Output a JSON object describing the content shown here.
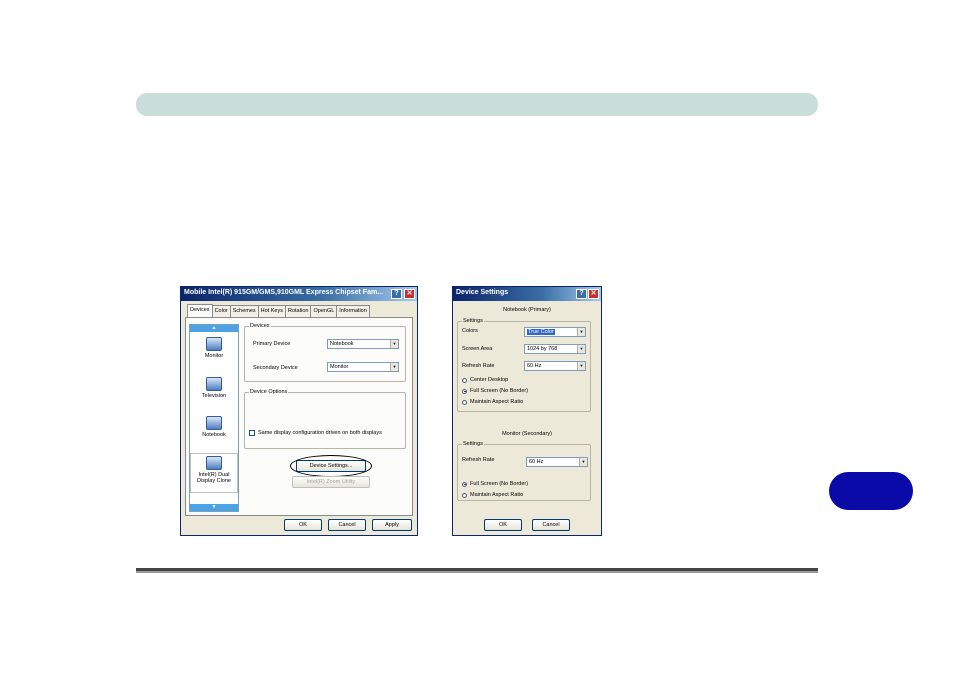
{
  "main_window": {
    "title": "Mobile Intel(R) 915GM/GMS,910GML Express Chipset Fam...",
    "help_glyph": "?",
    "close_glyph": "✕",
    "tabs": [
      "Devices",
      "Color",
      "Schemes",
      "Hot Keys",
      "Rotation",
      "OpenGL",
      "Information"
    ],
    "active_tab": "Devices",
    "sidebar": {
      "scroll_up": "▲",
      "scroll_down": "▼",
      "items": [
        {
          "label": "Monitor",
          "icon": "monitor-icon"
        },
        {
          "label": "Television",
          "icon": "television-icon"
        },
        {
          "label": "Notebook",
          "icon": "notebook-icon"
        },
        {
          "label": "Intel(R) Dual Display Clone",
          "icon": "dual-display-icon"
        }
      ]
    },
    "devices_group": {
      "label": "Devices",
      "primary_label": "Primary Device",
      "primary_value": "Notebook",
      "secondary_label": "Secondary Device",
      "secondary_value": "Monitor"
    },
    "options_group": {
      "label": "Device Options",
      "checkbox_label": "Same display configuration driven on both displays"
    },
    "device_settings_button": "Device Settings...",
    "zoom_button": "Intel(R) Zoom Utility",
    "ok_button": "OK",
    "cancel_button": "Cancel",
    "apply_button": "Apply"
  },
  "settings_window": {
    "title": "Device Settings",
    "help_glyph": "?",
    "close_glyph": "✕",
    "notebook_heading": "Notebook (Primary)",
    "notebook_group": {
      "label": "Settings",
      "colors_label": "Colors",
      "colors_value": "True Color",
      "area_label": "Screen Area",
      "area_value": "1024 by 768",
      "refresh_label": "Refresh Rate",
      "refresh_value": "60 Hz",
      "radios": [
        "Center Desktop",
        "Full Screen (No Border)",
        "Maintain Aspect Ratio"
      ],
      "selected_radio": 1
    },
    "monitor_heading": "Monitor (Secondary)",
    "monitor_group": {
      "label": "Settings",
      "refresh_label": "Refresh Rate",
      "refresh_value": "60 Hz",
      "radios": [
        "Full Screen (No Border)",
        "Maintain Aspect Ratio"
      ],
      "selected_radio": 0
    },
    "ok_button": "OK",
    "cancel_button": "Cancel"
  },
  "colors": {
    "header_bar": "#c9ddd9",
    "page_tab": "#0a0aa8",
    "titlebar": "#0a246a"
  }
}
